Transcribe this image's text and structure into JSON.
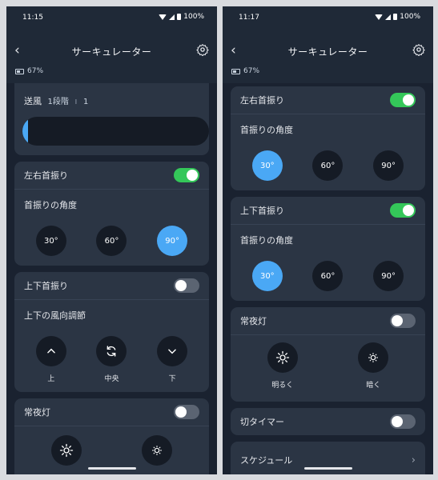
{
  "colors": {
    "accent": "#4aa8f5",
    "toggle_on": "#34c759",
    "toggle_off": "#5b6472",
    "card": "#2b3544",
    "bg": "#1f2937"
  },
  "left": {
    "status": {
      "time": "11:15",
      "battery": "100%"
    },
    "header": {
      "title": "サーキュレーター",
      "back_icon": "chevron-left-icon",
      "settings_icon": "gear-icon"
    },
    "device_battery": "67%",
    "fan": {
      "label": "送風",
      "level": "1段階",
      "value": "1",
      "slider_fraction": 0.03
    },
    "horizontal": {
      "label": "左右首振り",
      "on": true,
      "angle_label": "首振りの角度",
      "options": [
        "30°",
        "60°",
        "90°"
      ],
      "selected": 2
    },
    "vertical": {
      "label": "上下首振り",
      "on": false,
      "direction_label": "上下の風向調節",
      "buttons": [
        {
          "icon": "chevron-up-icon",
          "label": "上"
        },
        {
          "icon": "rotate-icon",
          "label": "中央"
        },
        {
          "icon": "chevron-down-icon",
          "label": "下"
        }
      ]
    },
    "nightlight": {
      "label": "常夜灯",
      "on": false
    }
  },
  "right": {
    "status": {
      "time": "11:17",
      "battery": "100%"
    },
    "header": {
      "title": "サーキュレーター",
      "back_icon": "chevron-left-icon",
      "settings_icon": "gear-icon"
    },
    "device_battery": "67%",
    "horizontal": {
      "label": "左右首振り",
      "on": true,
      "angle_label": "首振りの角度",
      "options": [
        "30°",
        "60°",
        "90°"
      ],
      "selected": 0
    },
    "vertical": {
      "label": "上下首振り",
      "on": true,
      "angle_label": "首振りの角度",
      "options": [
        "30°",
        "60°",
        "90°"
      ],
      "selected": 0
    },
    "nightlight": {
      "label": "常夜灯",
      "on": false,
      "bright_label": "明るく",
      "dim_label": "暗く"
    },
    "timer": {
      "label": "切タイマー",
      "on": false
    },
    "schedule": {
      "label": "スケジュール"
    }
  }
}
